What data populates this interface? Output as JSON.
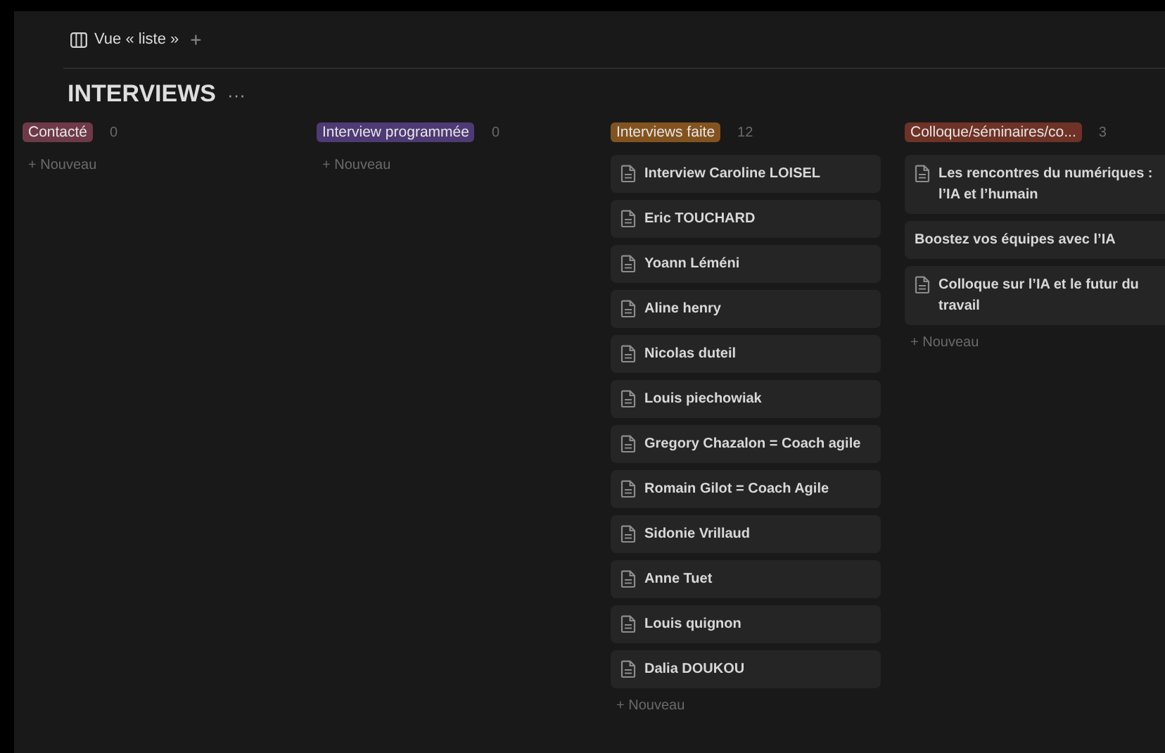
{
  "view_tab": {
    "label": "Vue « liste »",
    "add": "+"
  },
  "title": "INTERVIEWS",
  "title_menu": "···",
  "columns": [
    {
      "name": "Contacté",
      "color": "#6e3a48",
      "count": "0",
      "new_label": "+ Nouveau"
    },
    {
      "name": "Interview programmée",
      "color": "#4e3a74",
      "count": "0",
      "new_label": "+ Nouveau"
    },
    {
      "name": "Interviews faite",
      "color": "#83531f",
      "count": "12",
      "new_label": "+ Nouveau",
      "cards": [
        {
          "title": "Interview Caroline LOISEL",
          "page_icon": true
        },
        {
          "title": "Eric TOUCHARD",
          "page_icon": true
        },
        {
          "title": "Yoann Léméni",
          "page_icon": true
        },
        {
          "title": "Aline henry",
          "page_icon": true
        },
        {
          "title": "Nicolas duteil",
          "page_icon": true
        },
        {
          "title": "Louis piechowiak",
          "page_icon": true
        },
        {
          "title": "Gregory Chazalon = Coach agile",
          "page_icon": true
        },
        {
          "title": "Romain Gilot = Coach Agile",
          "page_icon": true
        },
        {
          "title": "Sidonie Vrillaud",
          "page_icon": true
        },
        {
          "title": "Anne Tuet",
          "page_icon": true
        },
        {
          "title": "Louis quignon",
          "page_icon": true
        },
        {
          "title": "Dalia DOUKOU",
          "page_icon": true
        }
      ]
    },
    {
      "name": "Colloque/séminaires/co...",
      "color": "#6f3226",
      "count": "3",
      "new_label": "+ Nouveau",
      "cards": [
        {
          "title": "Les rencontres du numériques : l’IA et l’humain",
          "page_icon": true
        },
        {
          "title": "Boostez vos équipes avec l’IA",
          "page_icon": false
        },
        {
          "title": "Colloque sur l’IA et le futur du travail",
          "page_icon": true
        }
      ]
    }
  ]
}
